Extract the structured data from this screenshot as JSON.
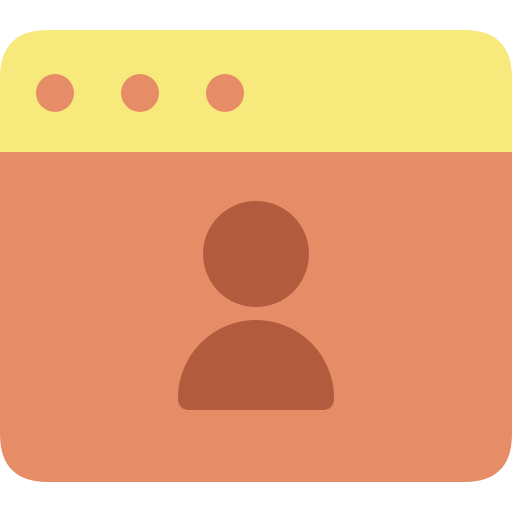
{
  "icon": {
    "name": "browser-window-user-icon",
    "colors": {
      "title_bar": "#F8E97C",
      "window_body": "#E68C67",
      "window_control_dots": "#E68C67",
      "user_silhouette": "#B35B3D"
    },
    "window_control_dot_count": 3
  }
}
